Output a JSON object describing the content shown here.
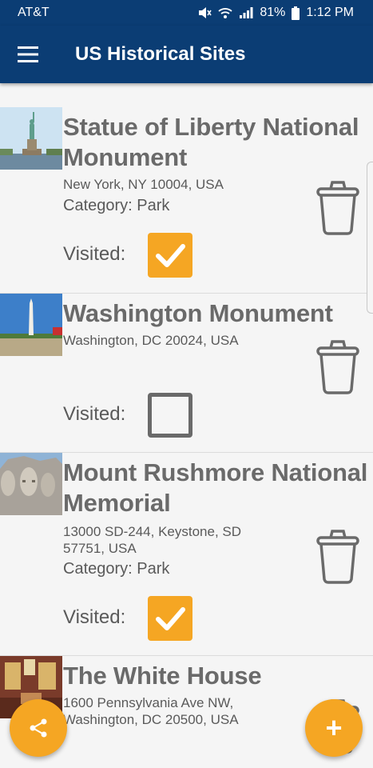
{
  "status": {
    "carrier": "AT&T",
    "battery": "81%",
    "time": "1:12 PM"
  },
  "app": {
    "title": "US Historical Sites",
    "menu_icon": "hamburger-icon"
  },
  "sites": [
    {
      "title_line1": "Statue of Liberty National",
      "title_line2": "Monument",
      "address": "New York, NY 10004, USA",
      "category": "Category: Park",
      "visited_label": "Visited:",
      "visited": true
    },
    {
      "title_line1": "Washington Monument",
      "address": "Washington, DC 20024, USA",
      "visited_label": "Visited:",
      "visited": false
    },
    {
      "title_line1": "Mount Rushmore National",
      "title_line2": "Memorial",
      "address_line1": "13000 SD-244, Keystone, SD",
      "address_line2": "57751, USA",
      "category": "Category: Park",
      "visited_label": "Visited:",
      "visited": true
    },
    {
      "title_line1": "The White House",
      "address_line1": "1600 Pennsylvania Ave NW,",
      "address_line2": "Washington, DC 20500, USA"
    }
  ],
  "fabs": {
    "share_icon": "share-icon",
    "add_label": "+"
  },
  "colors": {
    "app_bar": "#0b3d74",
    "accent": "#f5a623",
    "text": "#6a6a6a"
  }
}
